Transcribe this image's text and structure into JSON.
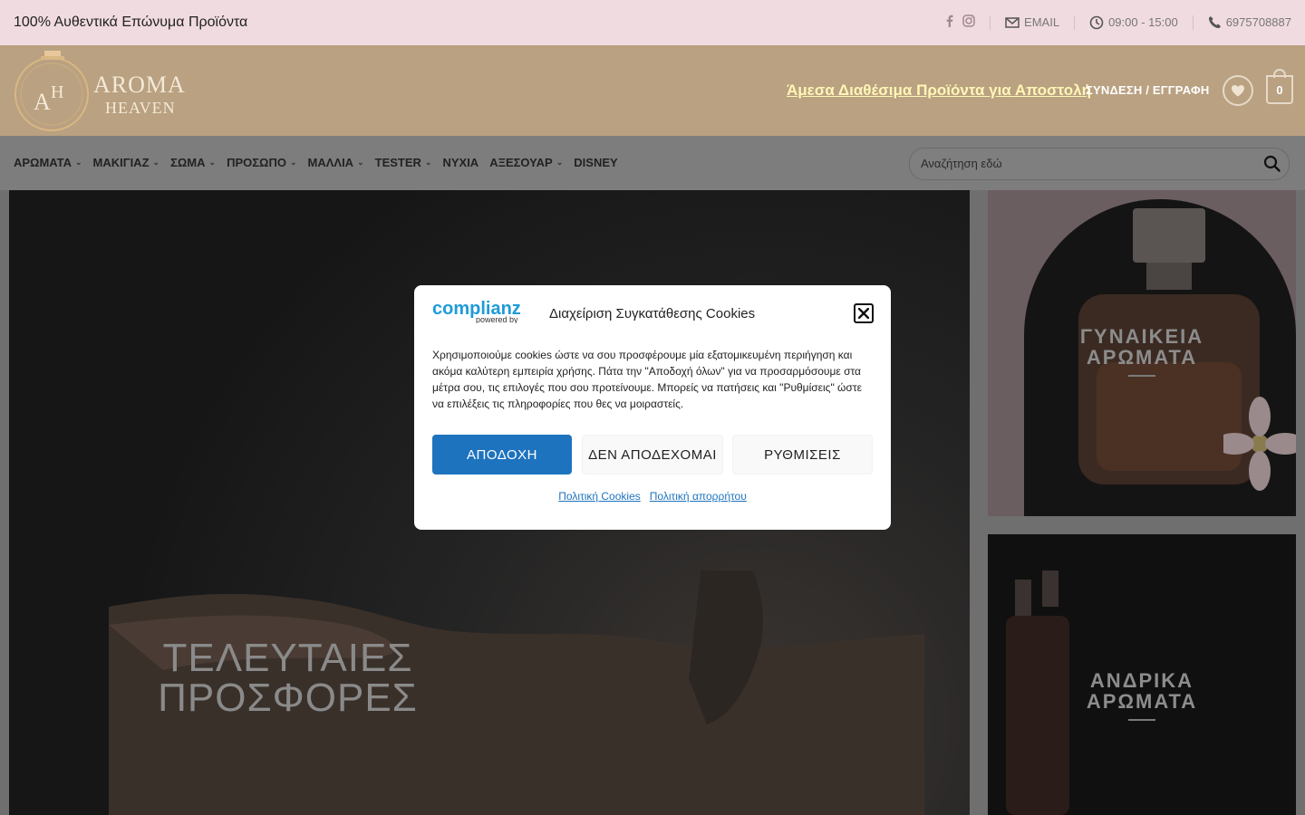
{
  "topbar": {
    "promo": "100% Αυθεντικά Επώνυμα Προϊόντα",
    "email_label": "EMAIL",
    "hours": "09:00 - 15:00",
    "phone": "6975708887"
  },
  "header": {
    "logo_monogram_left": "A",
    "logo_monogram_right": "H",
    "logo_line1": "AROMA",
    "logo_line2": "HEAVEN",
    "promo_link": "Άμεσα Διαθέσιμα Προϊόντα για Αποστολή",
    "login": "ΣΥΝΔΕΣΗ / ΕΓΓΡΑΦΗ",
    "cart_count": "0"
  },
  "nav": {
    "items": [
      {
        "label": "ΑΡΩΜΑΤΑ",
        "has_dropdown": true
      },
      {
        "label": "ΜΑΚΙΓΙΑΖ",
        "has_dropdown": true
      },
      {
        "label": "ΣΩΜΑ",
        "has_dropdown": true
      },
      {
        "label": "ΠΡΟΣΩΠΟ",
        "has_dropdown": true
      },
      {
        "label": "ΜΑΛΛΙΑ",
        "has_dropdown": true
      },
      {
        "label": "TESTER",
        "has_dropdown": true
      },
      {
        "label": "ΝΥΧΙΑ",
        "has_dropdown": false
      },
      {
        "label": "ΑΞΕΣΟΥΑΡ",
        "has_dropdown": true
      },
      {
        "label": "DISNEY",
        "has_dropdown": false
      }
    ],
    "search_placeholder": "Αναζήτηση εδώ"
  },
  "hero": {
    "title_line1": "ΤΕΛΕΥΤΑΙΕΣ",
    "title_line2": "ΠΡΟΣΦΟΡΕΣ"
  },
  "side_banners": [
    {
      "line1": "ΓΥΝΑΙΚΕΙΑ",
      "line2": "ΑΡΩΜΑΤΑ"
    },
    {
      "line1": "ΑΝΔΡΙΚΑ",
      "line2": "ΑΡΩΜΑΤΑ"
    }
  ],
  "cookie_modal": {
    "brand_name": "complianz",
    "brand_tagline": "powered by",
    "title": "Διαχείριση Συγκατάθεσης Cookies",
    "body": "Χρησιμοποιούμε cookies ώστε να σου προσφέρουμε μία εξατομικευμένη περιήγηση και ακόμα καλύτερη εμπειρία χρήσης. Πάτα την \"Αποδοχή όλων\" για να προσαρμόσουμε στα μέτρα σου, τις επιλογές που σου προτείνουμε. Μπορείς να πατήσεις και \"Ρυθμίσεις\" ώστε να επιλέξεις τις πληροφορίες που θες να μοιραστείς.",
    "accept": "ΑΠΟΔΟΧΗ",
    "deny": "ΔΕΝ ΑΠΟΔΕΧΟΜΑΙ",
    "settings": "ΡΥΘΜΙΣΕΙΣ",
    "cookie_policy": "Πολιτική Cookies",
    "privacy_policy": "Πολιτική απορρήτου"
  },
  "colors": {
    "topbar_bg": "#f0dbe0",
    "header_bg": "#b9a181",
    "accent_blue": "#1e73be",
    "promo_link": "#fff6b6"
  }
}
